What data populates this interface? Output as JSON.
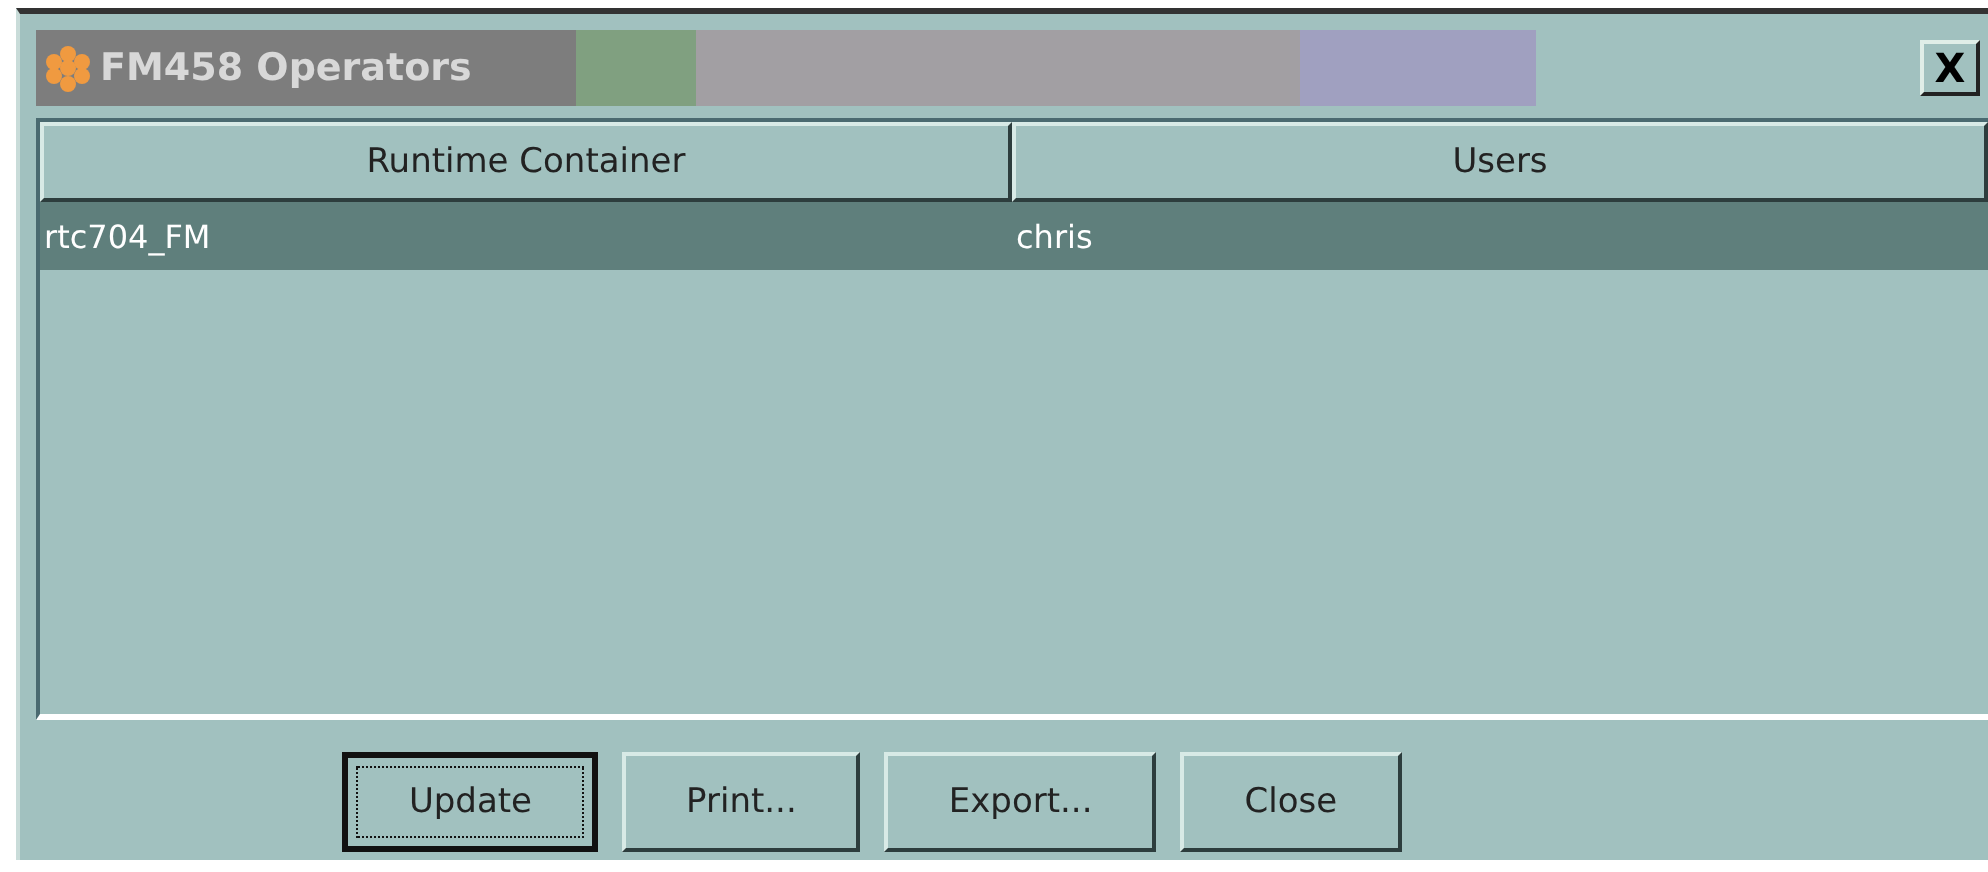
{
  "window": {
    "title": "FM458 Operators",
    "close": "X"
  },
  "table": {
    "columns": [
      "Runtime Container",
      "Users"
    ],
    "rows": [
      {
        "cells": [
          "rtc704_FM",
          "chris"
        ],
        "selected": true
      }
    ]
  },
  "buttons": [
    {
      "label": "Update",
      "default": true
    },
    {
      "label": "Print...",
      "default": false
    },
    {
      "label": "Export...",
      "default": false
    },
    {
      "label": "Close",
      "default": false
    }
  ]
}
